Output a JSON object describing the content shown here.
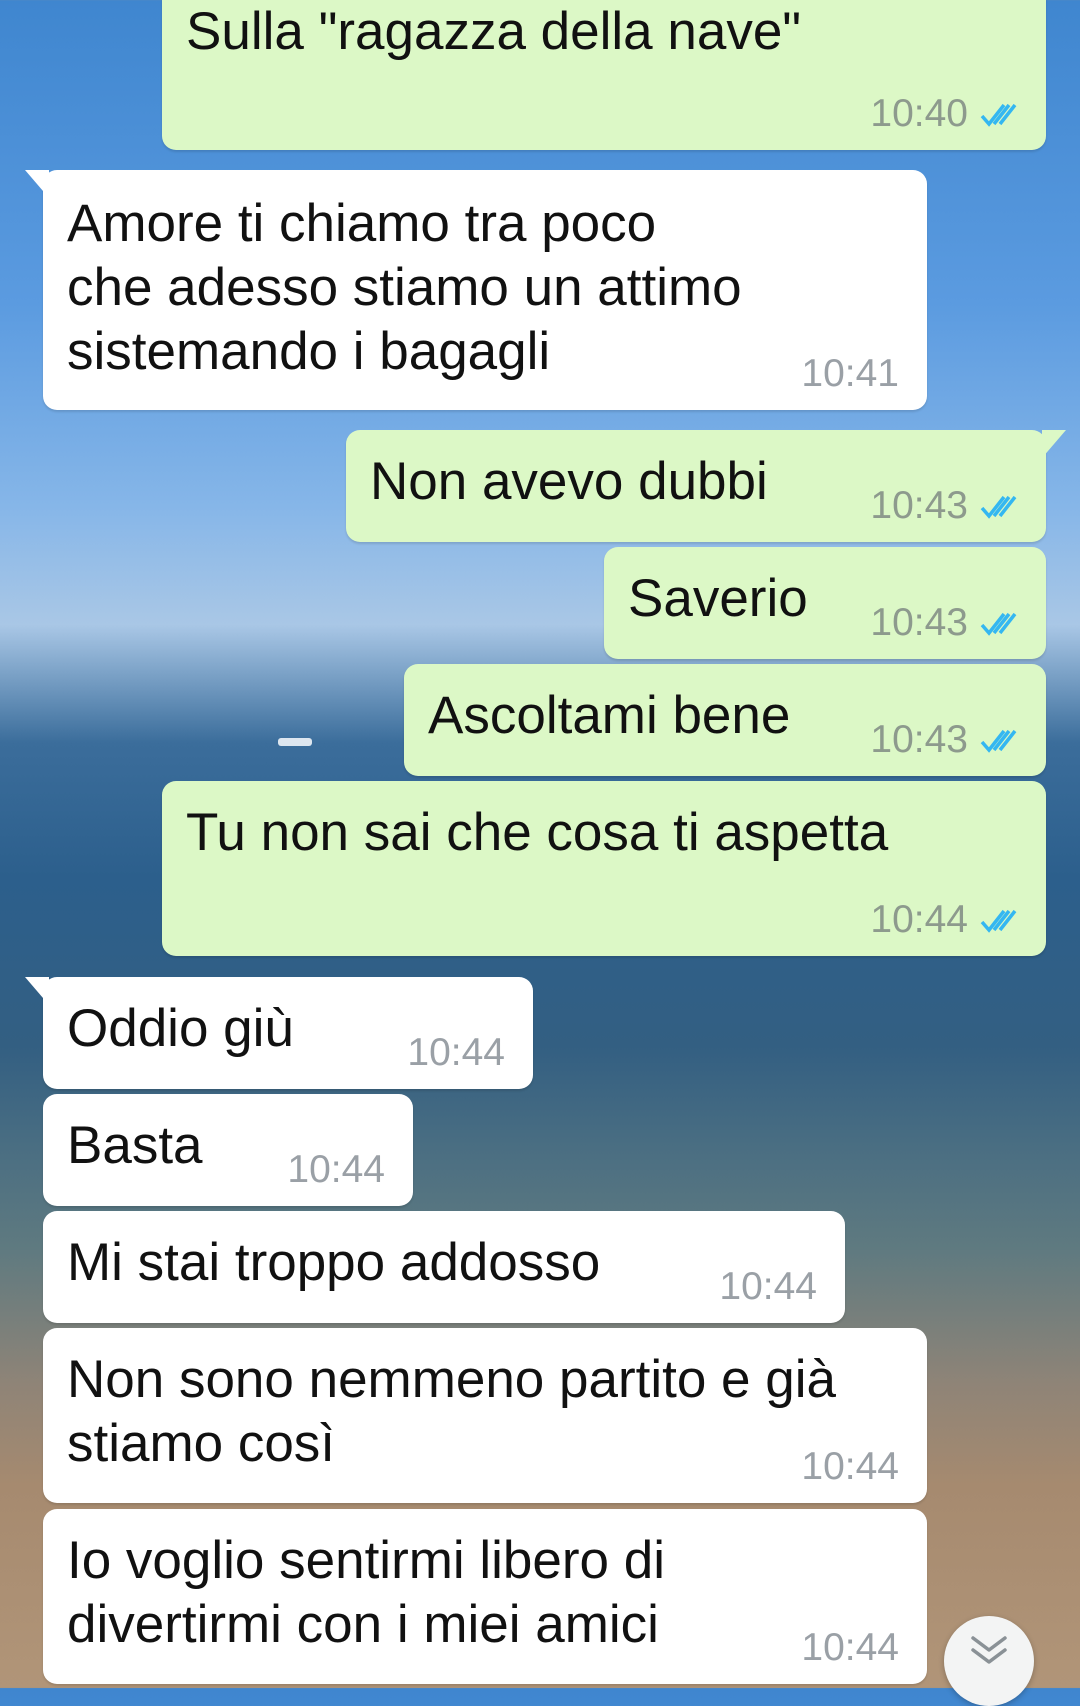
{
  "messages": [
    {
      "direction": "out",
      "text": "Sulla \"ragazza della nave\"",
      "time": "10:40",
      "status": "read"
    },
    {
      "direction": "in",
      "text": "Amore ti chiamo tra poco\nche adesso stiamo un attimo\nsistemando i bagagli",
      "time": "10:41"
    },
    {
      "direction": "out",
      "text": "Non avevo dubbi",
      "time": "10:43",
      "status": "read"
    },
    {
      "direction": "out",
      "text": "Saverio",
      "time": "10:43",
      "status": "read"
    },
    {
      "direction": "out",
      "text": "Ascoltami bene",
      "time": "10:43",
      "status": "read"
    },
    {
      "direction": "out",
      "text": "Tu non sai che cosa ti aspetta",
      "time": "10:44",
      "status": "read"
    },
    {
      "direction": "in",
      "text": "Oddio giù",
      "time": "10:44"
    },
    {
      "direction": "in",
      "text": "Basta",
      "time": "10:44"
    },
    {
      "direction": "in",
      "text": "Mi stai troppo addosso",
      "time": "10:44"
    },
    {
      "direction": "in",
      "text": "Non sono nemmeno partito e già\nstiamo così",
      "time": "10:44"
    },
    {
      "direction": "in",
      "text": "Io voglio sentirmi libero di\ndivertirmi con i miei amici",
      "time": "10:44"
    }
  ],
  "icons": {
    "read_receipt": "double-check-icon",
    "scroll_down": "chevron-double-down-icon"
  },
  "colors": {
    "outgoing_bubble": "#dcf8c6",
    "incoming_bubble": "#ffffff",
    "read_tick": "#34b7f1"
  }
}
